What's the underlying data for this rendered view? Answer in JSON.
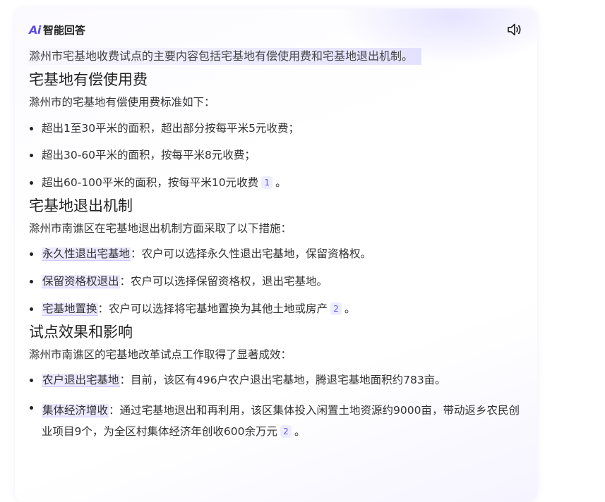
{
  "header": {
    "logo": "Ai",
    "title": "智能回答",
    "speaker_icon": "speaker-icon"
  },
  "intro": "滁州市宅基地收费试点的主要内容包括宅基地有偿使用费和宅基地退出机制。",
  "sections": [
    {
      "title": "宅基地有偿使用费",
      "para": "滁州市的宅基地有偿使用费标准如下：",
      "items": [
        {
          "text": "超出1至30平米的面积，超出部分按每平米5元收费；"
        },
        {
          "text": "超出30-60平米的面积，按每平米8元收费；"
        },
        {
          "text": "超出60-100平米的面积，按每平米10元收费",
          "cite": "1",
          "tail": "。"
        }
      ]
    },
    {
      "title": "宅基地退出机制",
      "para": "滁州市南谯区在宅基地退出机制方面采取了以下措施：",
      "items": [
        {
          "term": "永久性退出宅基地",
          "text": "：农户可以选择永久性退出宅基地，保留资格权。"
        },
        {
          "term": "保留资格权退出",
          "text": "：农户可以选择保留资格权，退出宅基地。"
        },
        {
          "term": "宅基地置换",
          "text": "：农户可以选择将宅基地置换为其他土地或房产",
          "cite": "2",
          "tail": "。"
        }
      ]
    },
    {
      "title": "试点效果和影响",
      "para": "滁州市南谯区的宅基地改革试点工作取得了显著成效：",
      "items": [
        {
          "term": "农户退出宅基地",
          "text": "：目前，该区有496户农户退出宅基地，腾退宅基地面积约783亩。"
        },
        {
          "term": "集体经济增收",
          "text": "：通过宅基地退出和再利用，该区集体投入闲置土地资源约9000亩，带动返乡农民创业项目9个，为全区村集体经济年创收600余万元",
          "cite": "2",
          "tail": "。"
        }
      ]
    }
  ],
  "colors": {
    "accent": "#5b4ae6",
    "highlight": "#ece9ff",
    "text": "#333333"
  }
}
